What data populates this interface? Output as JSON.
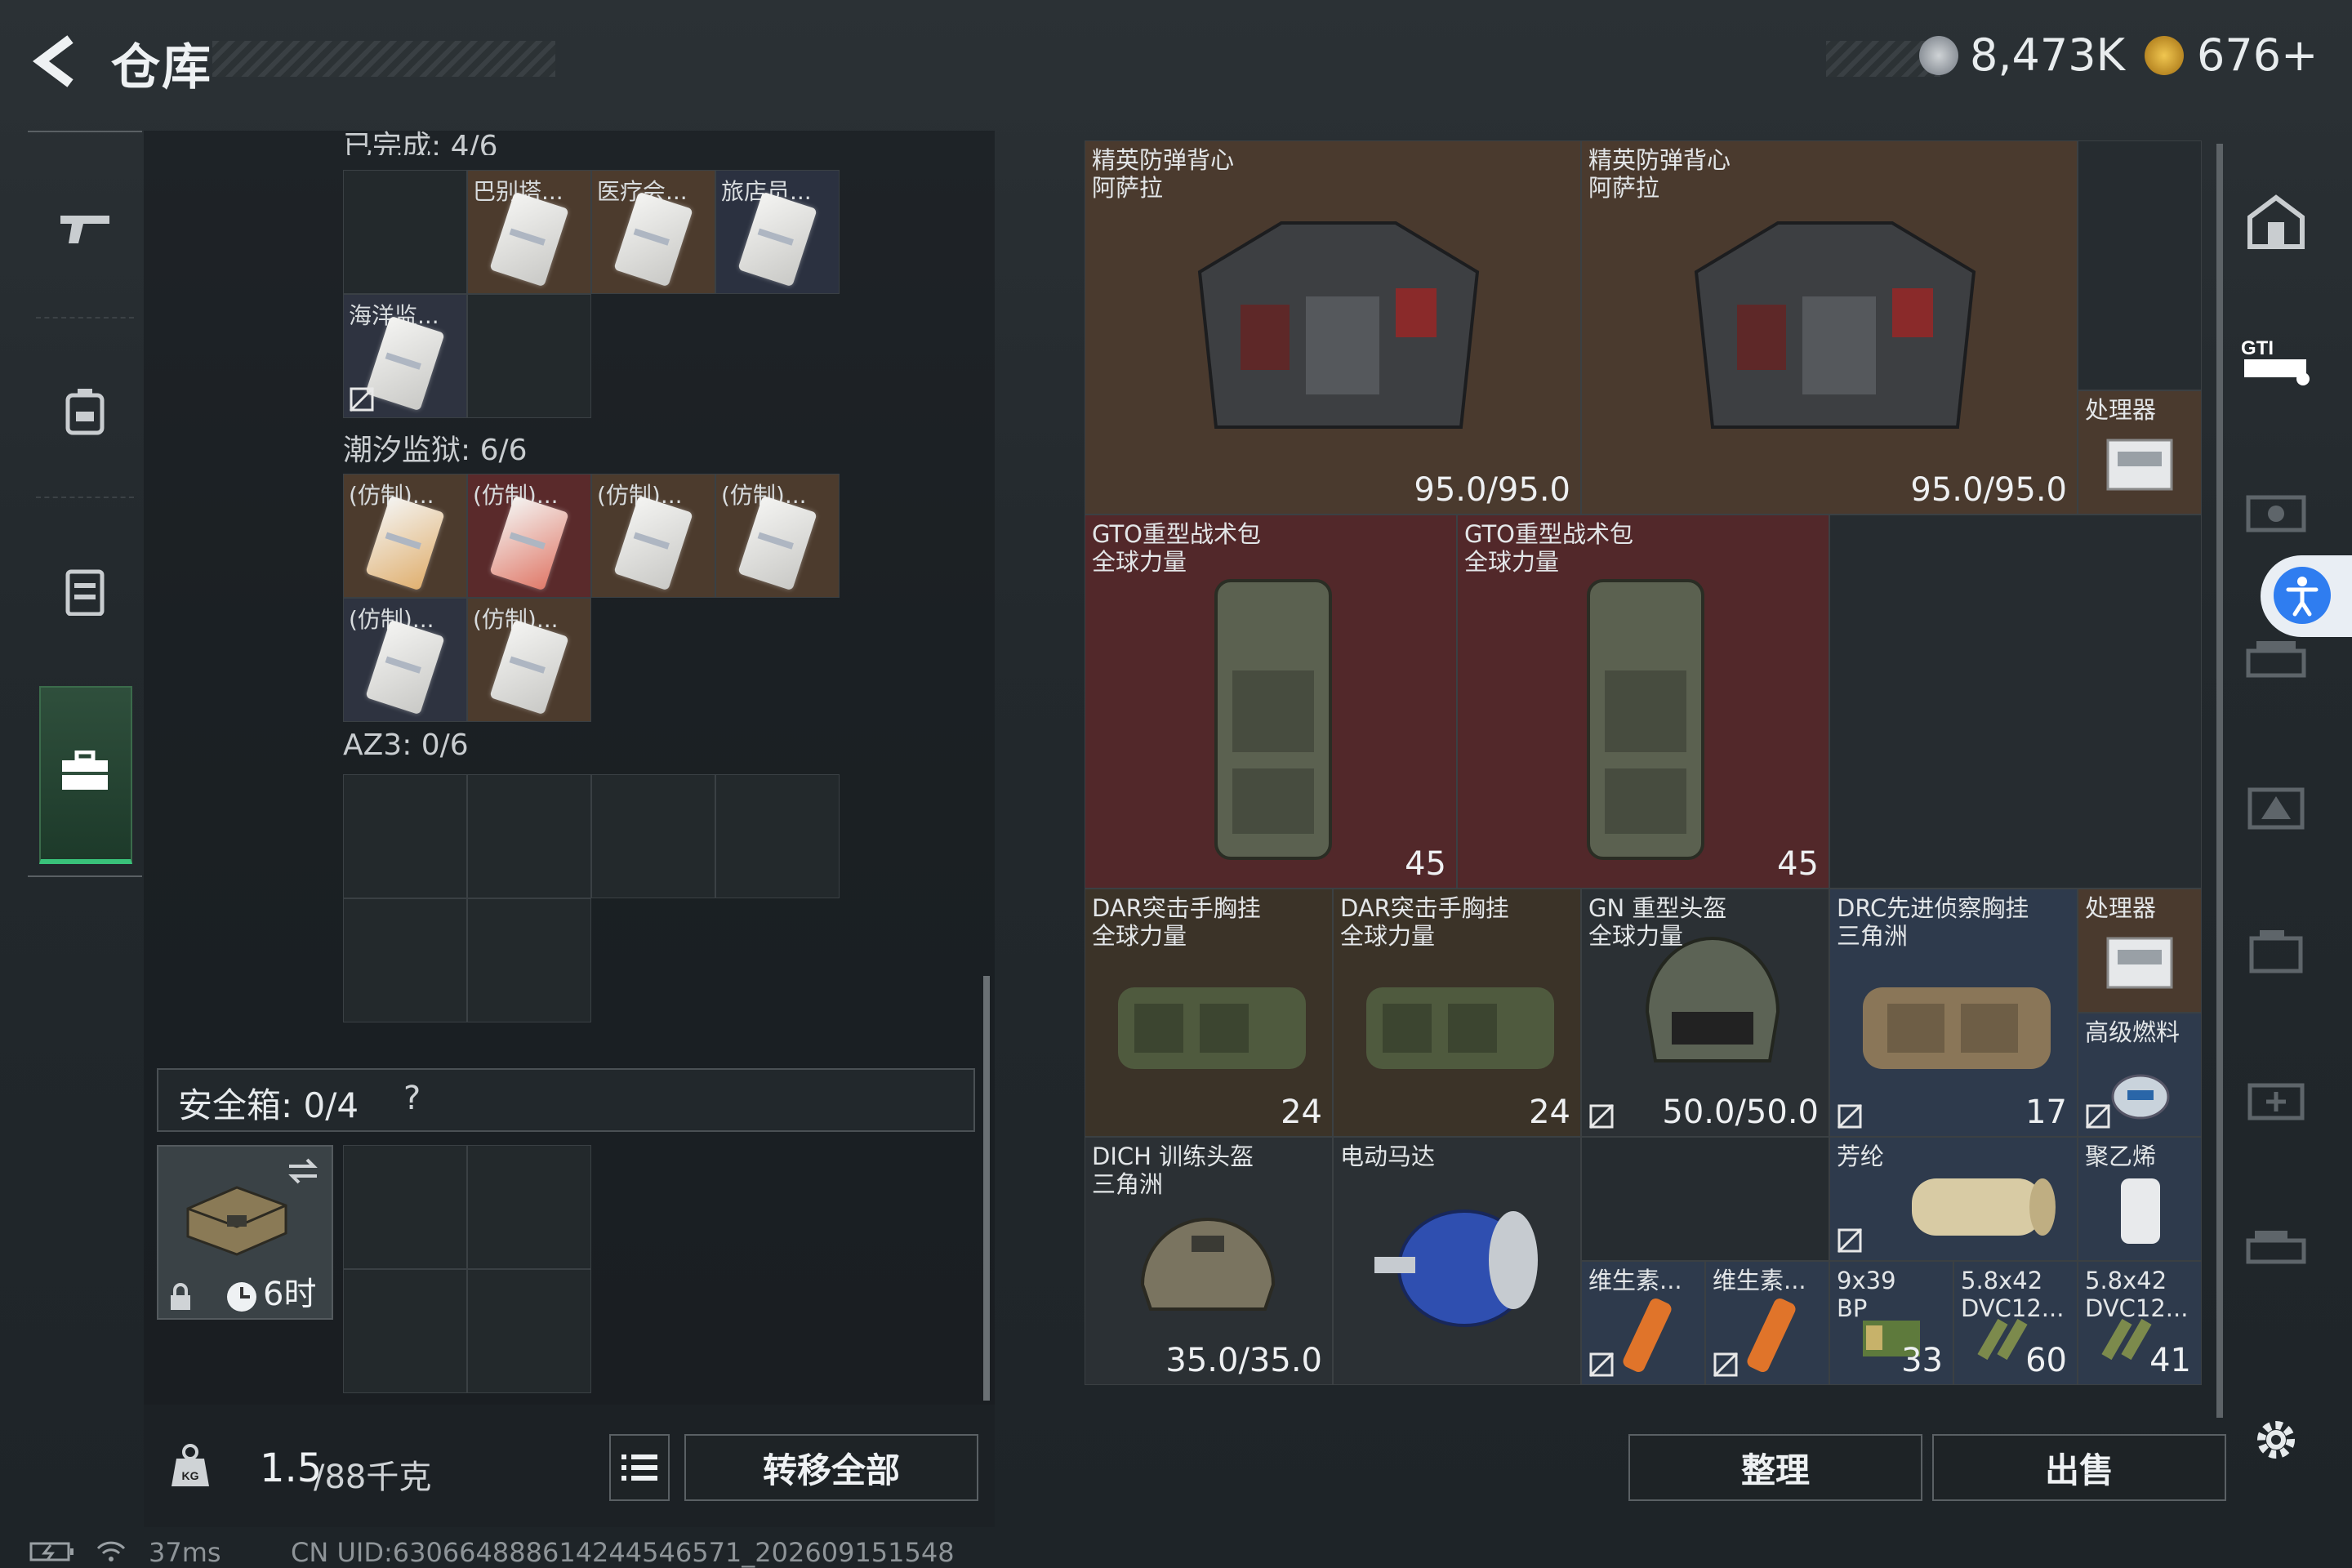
{
  "header": {
    "title": "仓库",
    "money": "8,473K",
    "coins": "676+"
  },
  "left_nav": {
    "items": [
      "gun-icon",
      "backpack-icon",
      "vest-icon",
      "toolbox-icon"
    ]
  },
  "container": {
    "partial_header": "已完成: 4/6",
    "row1_labels": [
      "巴别塔...",
      "医疗会...",
      "旅店员..."
    ],
    "row2_label": "海洋监...",
    "section2": "潮汐监狱: 6/6",
    "fake_label": "(仿制)...",
    "section3": "AZ3: 0/6"
  },
  "safebox": {
    "label": "安全箱: 0/4",
    "help": "?",
    "timer": "6时"
  },
  "weight": {
    "value": "1.5",
    "max": "/88千克"
  },
  "transfer_all": "转移全部",
  "stash": {
    "vest1": {
      "name": "精英防弹背心\n阿萨拉",
      "value": "95.0/95.0"
    },
    "vest2": {
      "name": "精英防弹背心\n阿萨拉",
      "value": "95.0/95.0"
    },
    "cpu1": {
      "name": "处理器"
    },
    "bag1": {
      "name": "GTO重型战术包\n全球力量",
      "value": "45"
    },
    "bag2": {
      "name": "GTO重型战术包\n全球力量",
      "value": "45"
    },
    "rig1": {
      "name": "DAR突击手胸挂\n全球力量",
      "value": "24"
    },
    "rig2": {
      "name": "DAR突击手胸挂\n全球力量",
      "value": "24"
    },
    "helmet1": {
      "name": "GN 重型头盔\n全球力量",
      "value": "50.0/50.0"
    },
    "rig3": {
      "name": "DRC先进侦察胸挂\n三角洲",
      "value": "17"
    },
    "cpu2": {
      "name": "处理器"
    },
    "fuel": {
      "name": "高级燃料"
    },
    "helmet2": {
      "name": "DICH 训练头盔\n三角洲",
      "value": "35.0/35.0"
    },
    "motor": {
      "name": "电动马达"
    },
    "aramid": {
      "name": "芳纶"
    },
    "pe": {
      "name": "聚乙烯"
    },
    "vit1": {
      "name": "维生素..."
    },
    "vit2": {
      "name": "维生素..."
    },
    "ammo1": {
      "name": "9x39\nBP",
      "value": "33"
    },
    "ammo2": {
      "name": "5.8x42\nDVC12...",
      "value": "60"
    },
    "ammo3": {
      "name": "5.8x42\nDVC12...",
      "value": "41"
    }
  },
  "buttons": {
    "sort": "整理",
    "sell": "出售"
  },
  "status": {
    "ping": "37ms",
    "uid": "CN UID:630664888614244546571_202609151548"
  },
  "colors": {
    "accent_green": "#39c27a",
    "brown_cell": "#4c3b2d",
    "red_cell": "#5a2a2b",
    "accessibility_blue": "#2f7df0"
  }
}
